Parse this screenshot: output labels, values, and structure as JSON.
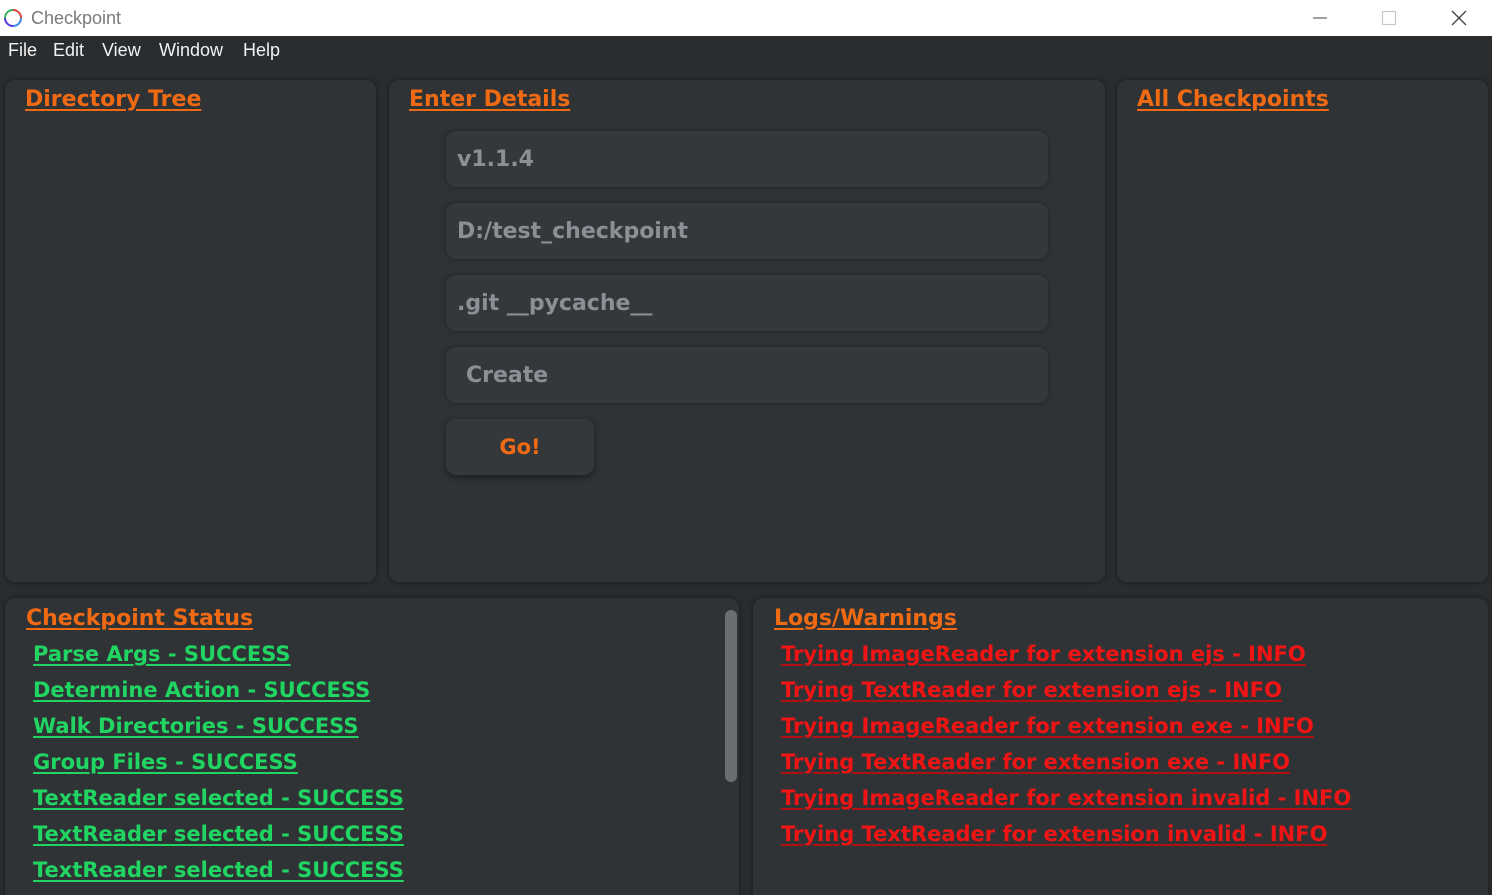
{
  "window": {
    "title": "Checkpoint"
  },
  "menu": [
    "File",
    "Edit",
    "View",
    "Window",
    "Help"
  ],
  "panels": {
    "directory_tree": {
      "title": "Directory Tree"
    },
    "enter_details": {
      "title": "Enter Details",
      "fields": [
        {
          "value": "v1.1.4"
        },
        {
          "value": "D:/test_checkpoint"
        },
        {
          "value": ".git __pycache__"
        },
        {
          "value": "Create"
        }
      ],
      "go_label": "Go!"
    },
    "all_checkpoints": {
      "title": "All Checkpoints"
    },
    "checkpoint_status": {
      "title": "Checkpoint Status",
      "lines": [
        "Parse Args - SUCCESS",
        "Determine Action - SUCCESS",
        "Walk Directories - SUCCESS",
        "Group Files - SUCCESS",
        "TextReader selected - SUCCESS",
        "TextReader selected - SUCCESS",
        "TextReader selected - SUCCESS"
      ]
    },
    "logs_warnings": {
      "title": "Logs/Warnings",
      "lines": [
        "Trying ImageReader for extension ejs - INFO",
        "Trying TextReader for extension ejs - INFO",
        "Trying ImageReader for extension exe - INFO",
        "Trying TextReader for extension exe - INFO",
        "Trying ImageReader for extension invalid - INFO",
        "Trying TextReader for extension invalid - INFO"
      ]
    }
  },
  "colors": {
    "accent": "#f06a14",
    "success": "#21d562",
    "log": "#f01414",
    "background": "#2a2d30",
    "panel": "#303336"
  }
}
